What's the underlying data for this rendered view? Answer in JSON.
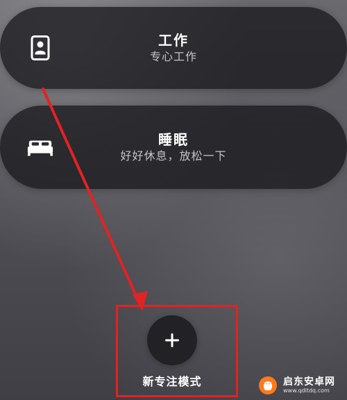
{
  "cards": [
    {
      "title": "工作",
      "subtitle": "专心工作",
      "icon": "id-badge-icon"
    },
    {
      "title": "睡眠",
      "subtitle": "好好休息，放松一下",
      "icon": "bed-icon"
    }
  ],
  "new_focus": {
    "label": "新专注模式",
    "icon": "plus-icon"
  },
  "annotation": {
    "arrow_color": "#e32222",
    "box_color": "#e32222"
  },
  "watermark": {
    "text": "启东安卓网",
    "url": "www.qdltdq.com",
    "logo": "android-logo-icon"
  }
}
